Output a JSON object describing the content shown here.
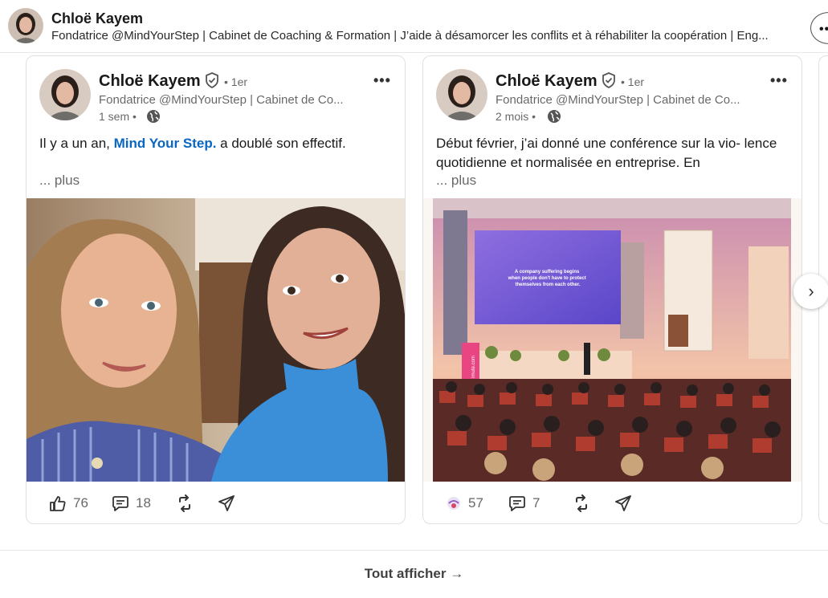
{
  "profile": {
    "name": "Chloë Kayem",
    "headline": "Fondatrice @MindYourStep | Cabinet de Coaching & Formation | J’aide à désamorcer les conflits et à réhabiliter la coopération | Eng..."
  },
  "posts": [
    {
      "author": "Chloë Kayem",
      "degree": "• 1er",
      "headline": "Fondatrice @MindYourStep | Cabinet de Co...",
      "time": "1 sem •",
      "text_before": "Il y a un an, ",
      "text_link": "Mind Your Step.",
      "text_after": " a doublé son effectif.",
      "more": "... plus",
      "reactions": "76",
      "comments": "18",
      "image_icon": "selfie-photo"
    },
    {
      "author": "Chloë Kayem",
      "degree": "• 1er",
      "headline": "Fondatrice @MindYourStep | Cabinet de Co...",
      "time": "2 mois •",
      "text": "Début février, j’ai donné une conférence sur la vio- lence quotidienne et normalisée en entreprise. En",
      "more": "... plus",
      "reactions": "57",
      "comments": "7",
      "slide_text": "A company suffering begins when people don't have to protect themselves from each other.",
      "banner_text": "imute.com",
      "image_icon": "conference-photo"
    }
  ],
  "icons": {
    "verified": "verified-shield-icon",
    "globe": "globe-icon",
    "like": "thumbs-up-icon",
    "comment": "comment-icon",
    "repost": "repost-icon",
    "send": "send-icon",
    "next": "chevron-right-icon"
  },
  "footer": {
    "show_all": "Tout afficher →"
  },
  "colors": {
    "link": "#0a66c2",
    "muted": "#666666",
    "border": "#e0e0e0"
  }
}
